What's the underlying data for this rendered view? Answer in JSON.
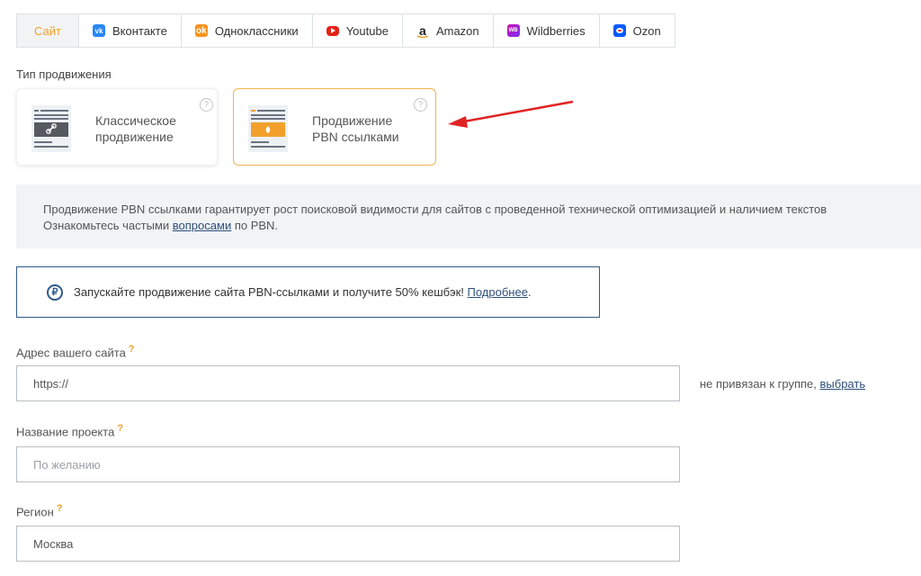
{
  "tabs": [
    {
      "label": "Сайт",
      "icon": "none",
      "color": "#f3a02b"
    },
    {
      "label": "Вконтакте",
      "icon": "vk-icon",
      "color": "#2787f5"
    },
    {
      "label": "Одноклассники",
      "icon": "ok-icon",
      "color": "#f7931e"
    },
    {
      "label": "Youtube",
      "icon": "youtube-icon",
      "color": "#e62117"
    },
    {
      "label": "Amazon",
      "icon": "amazon-icon",
      "color": "#222222"
    },
    {
      "label": "Wildberries",
      "icon": "wildberries-icon",
      "color": "#cb11ab"
    },
    {
      "label": "Ozon",
      "icon": "ozon-icon",
      "color": "#005bff"
    }
  ],
  "promotion": {
    "title": "Тип продвижения",
    "classic": {
      "line1": "Классическое",
      "line2": "продвижение"
    },
    "pbn": {
      "line1": "Продвижение",
      "line2": "PBN ссылками"
    }
  },
  "info": {
    "line1": "Продвижение PBN ссылками гарантирует рост поисковой видимости для сайтов с проведенной технической оптимизацией и наличием текстов",
    "line2_prefix": "Ознакомьтесь частыми ",
    "line2_link": "вопросами",
    "line2_suffix": " по PBN."
  },
  "promo": {
    "symbol": "₽",
    "text": "Запускайте продвижение сайта PBN-ссылками и получите 50% кешбэк! ",
    "link": "Подробнее",
    "suffix": "."
  },
  "site_field": {
    "label": "Адрес вашего сайта",
    "value": "https://",
    "group_text": "не привязан к группе, ",
    "group_link": "выбрать"
  },
  "project_field": {
    "label": "Название проекта",
    "placeholder": "По желанию"
  },
  "region_field": {
    "label": "Регион",
    "value": "Москва"
  },
  "help_mark": "?",
  "colors": {
    "accent": "#f3a02b",
    "link": "#2f4f7a",
    "arrow": "#e02424",
    "border_active": "#f3b24e"
  }
}
